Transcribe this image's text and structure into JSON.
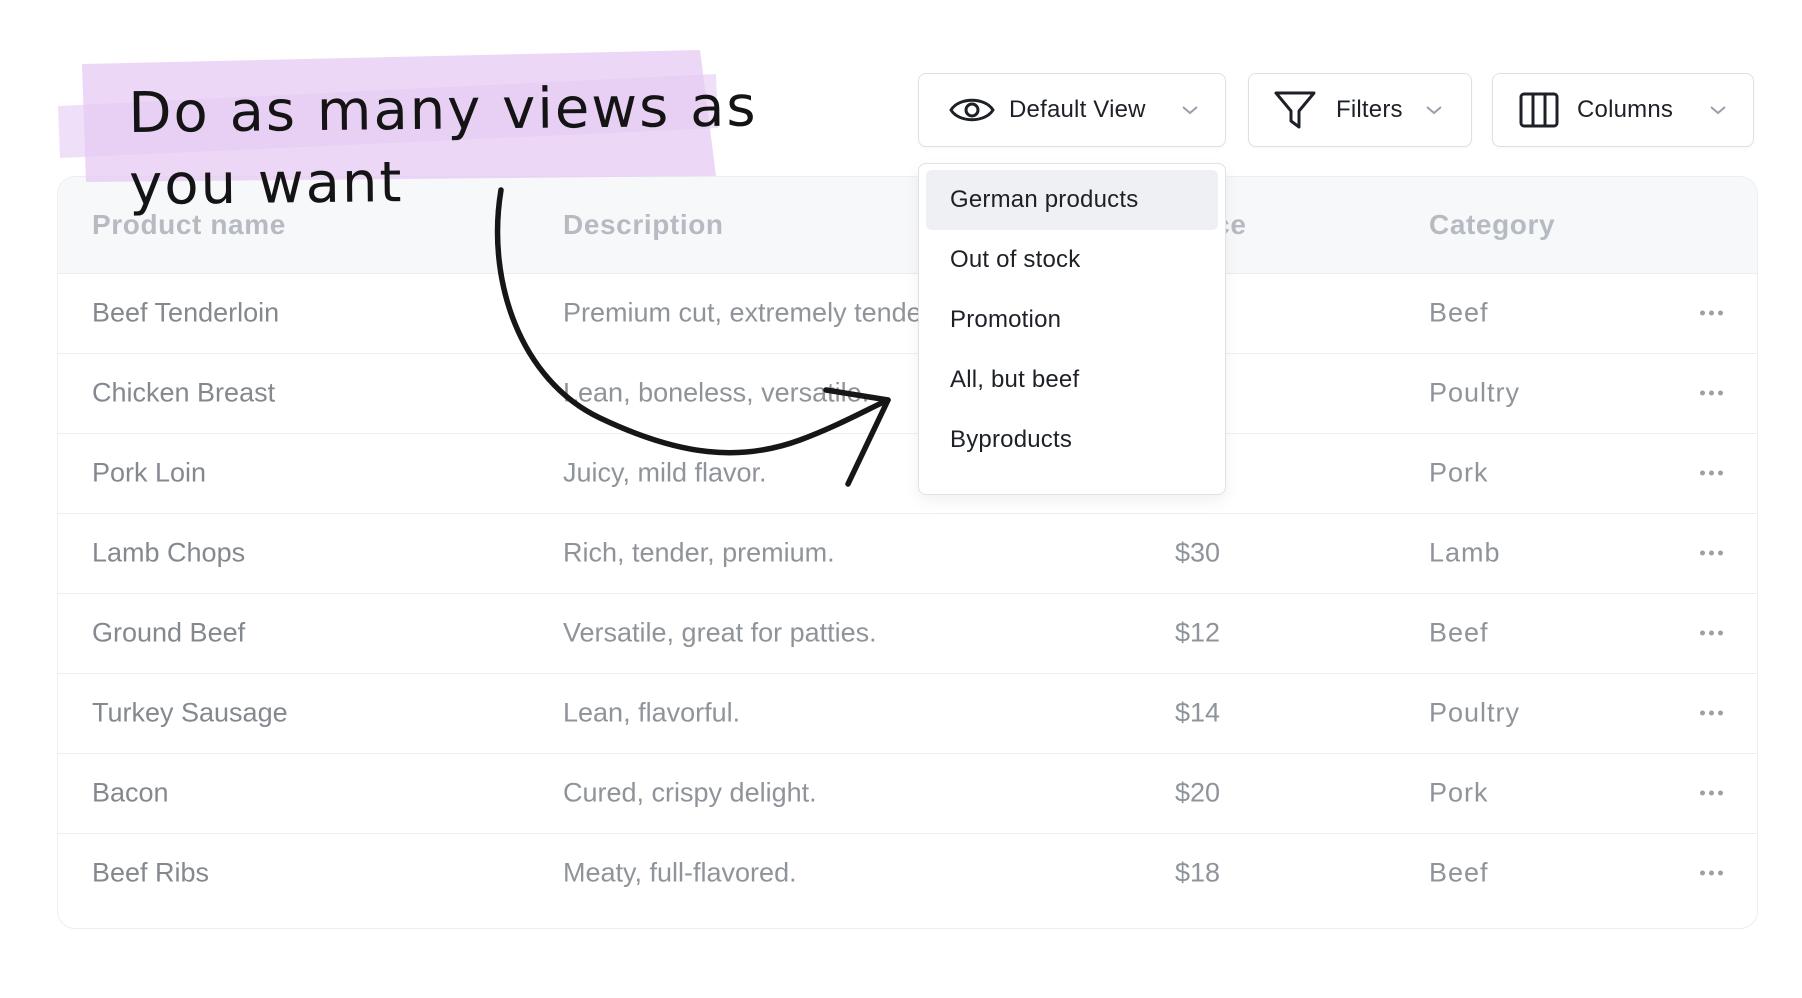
{
  "toolbar": {
    "view_button": {
      "label": "Default View",
      "icon": "eye-icon"
    },
    "filters_button": {
      "label": "Filters",
      "icon": "funnel-icon"
    },
    "columns_button": {
      "label": "Columns",
      "icon": "columns-icon"
    }
  },
  "view_menu": {
    "items": [
      {
        "label": "German products",
        "selected": true
      },
      {
        "label": "Out of stock",
        "selected": false
      },
      {
        "label": "Promotion",
        "selected": false
      },
      {
        "label": "All, but beef",
        "selected": false
      },
      {
        "label": "Byproducts",
        "selected": false
      }
    ]
  },
  "table": {
    "headers": {
      "name": "Product name",
      "description": "Description",
      "price": "Price",
      "category": "Category"
    },
    "rows": [
      {
        "name": "Beef Tenderloin",
        "description": "Premium cut, extremely tender.",
        "price": "",
        "category": "Beef"
      },
      {
        "name": "Chicken Breast",
        "description": "Lean, boneless, versatile.",
        "price": "",
        "category": "Poultry"
      },
      {
        "name": "Pork Loin",
        "description": "Juicy, mild flavor.",
        "price": "",
        "category": "Pork"
      },
      {
        "name": "Lamb Chops",
        "description": "Rich, tender, premium.",
        "price": "$30",
        "category": "Lamb"
      },
      {
        "name": "Ground Beef",
        "description": "Versatile, great for patties.",
        "price": "$12",
        "category": "Beef"
      },
      {
        "name": "Turkey Sausage",
        "description": "Lean, flavorful.",
        "price": "$14",
        "category": "Poultry"
      },
      {
        "name": "Bacon",
        "description": "Cured, crispy delight.",
        "price": "$20",
        "category": "Pork"
      },
      {
        "name": "Beef Ribs",
        "description": "Meaty, full-flavored.",
        "price": "$18",
        "category": "Beef"
      }
    ],
    "row_action_icon": "more-horizontal-icon"
  },
  "annotation": {
    "line1": "Do as many views as",
    "line2": "you want",
    "highlight_color": "#e6c9f3"
  },
  "colors": {
    "header_bg": "#f7f8fa",
    "border": "#eceef1",
    "menu_selected_bg": "#eef0f3"
  }
}
